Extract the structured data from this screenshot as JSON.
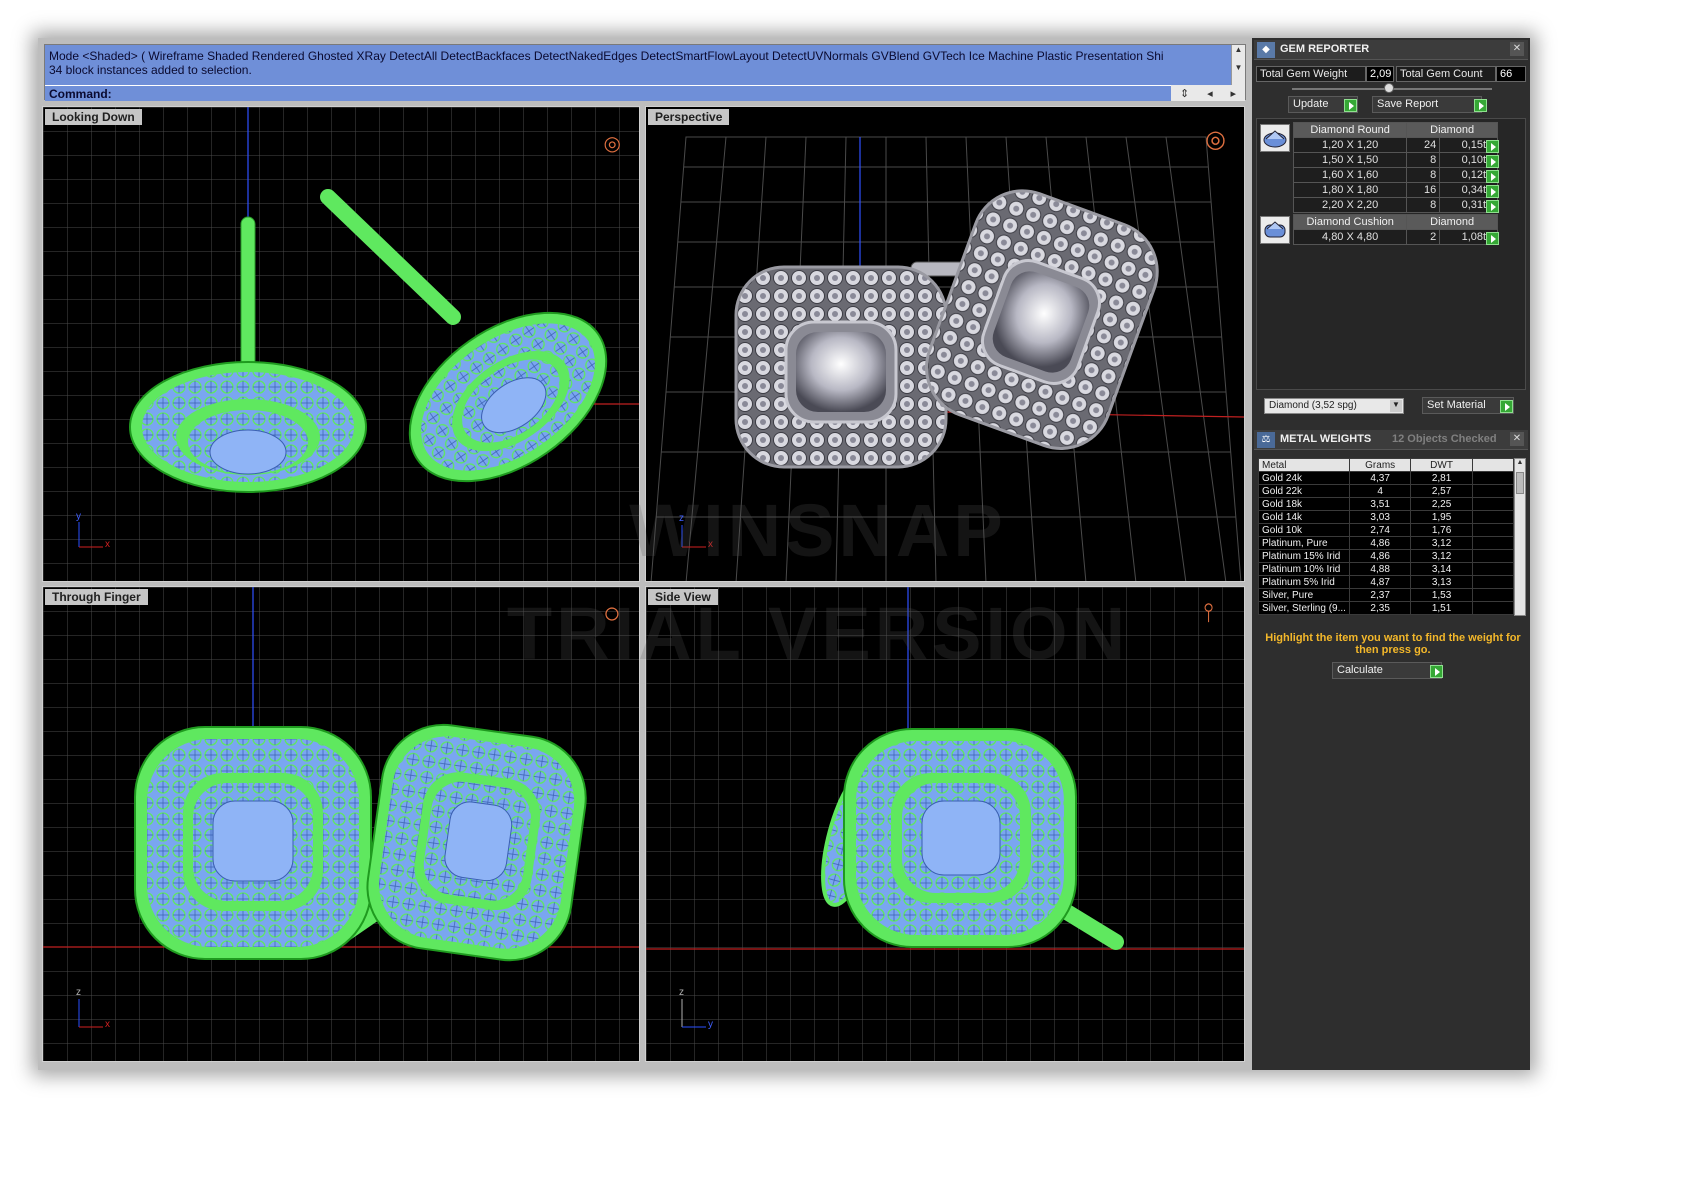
{
  "command": {
    "mode_line": "Mode <Shaded> ( Wireframe  Shaded  Rendered  Ghosted  XRay  DetectAll  DetectBackfaces  DetectNakedEdges  DetectSmartFlowLayout  DetectUVNormals  GVBlend  GVTech  Ice  Machine  Plastic  Presentation  Shi",
    "status_line": "34 block instances added to selection.",
    "prompt": "Command:"
  },
  "viewports": {
    "top": {
      "title": "Looking Down",
      "axis_x": "x",
      "axis_y": "y"
    },
    "perspective": {
      "title": "Perspective",
      "axis_x": "x",
      "axis_y": "z"
    },
    "front": {
      "title": "Through Finger",
      "axis_x": "x",
      "axis_y": "z"
    },
    "side": {
      "title": "Side View",
      "axis_x": "y",
      "axis_y": "z"
    }
  },
  "watermark": {
    "line1": "WINSNAP",
    "line2": "TRIAL VERSION"
  },
  "gem_reporter": {
    "title": "GEM REPORTER",
    "total_weight_label": "Total Gem Weight",
    "total_weight": "2,09",
    "total_count_label": "Total Gem Count",
    "total_count": "66",
    "update_label": "Update",
    "save_report_label": "Save Report",
    "groups": [
      {
        "cut": "Diamond Round",
        "material": "Diamond",
        "rows": [
          {
            "size": "1,20 X 1,20",
            "count": "24",
            "weight": "0,15tw"
          },
          {
            "size": "1,50 X 1,50",
            "count": "8",
            "weight": "0,10tw"
          },
          {
            "size": "1,60 X 1,60",
            "count": "8",
            "weight": "0,12tw"
          },
          {
            "size": "1,80 X 1,80",
            "count": "16",
            "weight": "0,34tw"
          },
          {
            "size": "2,20 X 2,20",
            "count": "8",
            "weight": "0,31tw"
          }
        ]
      },
      {
        "cut": "Diamond Cushion",
        "material": "Diamond",
        "rows": [
          {
            "size": "4,80 X 4,80",
            "count": "2",
            "weight": "1,08tw"
          }
        ]
      }
    ],
    "material_select": "Diamond    (3,52 spg)",
    "set_material_label": "Set Material"
  },
  "metal_weights": {
    "title": "METAL WEIGHTS",
    "objects_checked": "12 Objects Checked",
    "columns": [
      "Metal",
      "Grams",
      "DWT"
    ],
    "rows": [
      [
        "Gold 24k",
        "4,37",
        "2,81"
      ],
      [
        "Gold 22k",
        "4",
        "2,57"
      ],
      [
        "Gold 18k",
        "3,51",
        "2,25"
      ],
      [
        "Gold 14k",
        "3,03",
        "1,95"
      ],
      [
        "Gold 10k",
        "2,74",
        "1,76"
      ],
      [
        "Platinum, Pure",
        "4,86",
        "3,12"
      ],
      [
        "Platinum 15% Irid",
        "4,86",
        "3,12"
      ],
      [
        "Platinum 10% Irid",
        "4,88",
        "3,14"
      ],
      [
        "Platinum 5% Irid",
        "4,87",
        "3,13"
      ],
      [
        "Silver, Pure",
        "2,37",
        "1,53"
      ],
      [
        "Silver, Sterling (9...",
        "2,35",
        "1,51"
      ]
    ],
    "hint": "Highlight the item you want to find the weight for then press go.",
    "calculate_label": "Calculate"
  },
  "colors": {
    "wire_green": "#5fe85f",
    "gem_blue": "#7aa6f0",
    "command_bg": "#6f8fd8",
    "panel_bg": "#2e2e2e",
    "hint_text": "#f4b82a"
  }
}
